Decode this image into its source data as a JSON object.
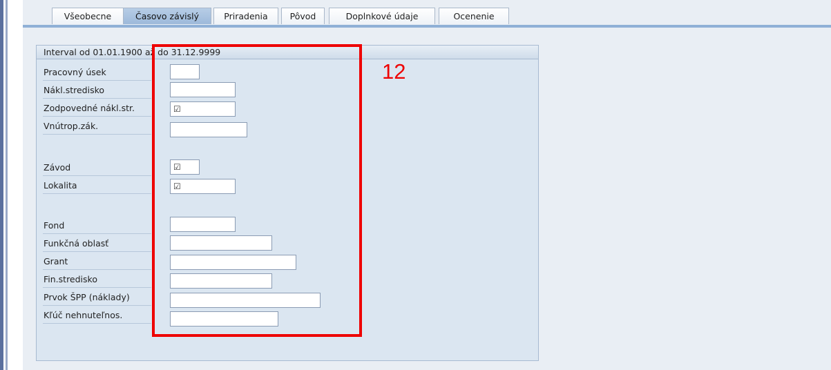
{
  "tabs": [
    {
      "label": "Všeobecne",
      "active": false
    },
    {
      "label": "Časovo závislý",
      "active": true
    },
    {
      "label": "Priradenia",
      "active": false
    },
    {
      "label": "Pôvod",
      "active": false
    },
    {
      "label": "Doplnkové údaje",
      "active": false
    },
    {
      "label": "Ocenenie",
      "active": false
    }
  ],
  "panel": {
    "title": "Interval od 01.01.1900 až do 31.12.9999"
  },
  "fields": [
    {
      "label": "Pracovný úsek",
      "value": ""
    },
    {
      "label": "Nákl.stredisko",
      "value": ""
    },
    {
      "label": "Zodpovedné nákl.str.",
      "value": "☑"
    },
    {
      "label": "Vnútrop.zák.",
      "value": ""
    },
    {
      "label": "Závod",
      "value": "☑"
    },
    {
      "label": "Lokalita",
      "value": "☑"
    },
    {
      "label": "Fond",
      "value": ""
    },
    {
      "label": "Funkčná oblasť",
      "value": ""
    },
    {
      "label": "Grant",
      "value": ""
    },
    {
      "label": "Fin.stredisko",
      "value": ""
    },
    {
      "label": "Prvok ŠPP (náklady)",
      "value": ""
    },
    {
      "label": "Kľúč nehnuteľnos.",
      "value": ""
    }
  ],
  "annotation": {
    "number": "12",
    "color": "#ee0000"
  }
}
